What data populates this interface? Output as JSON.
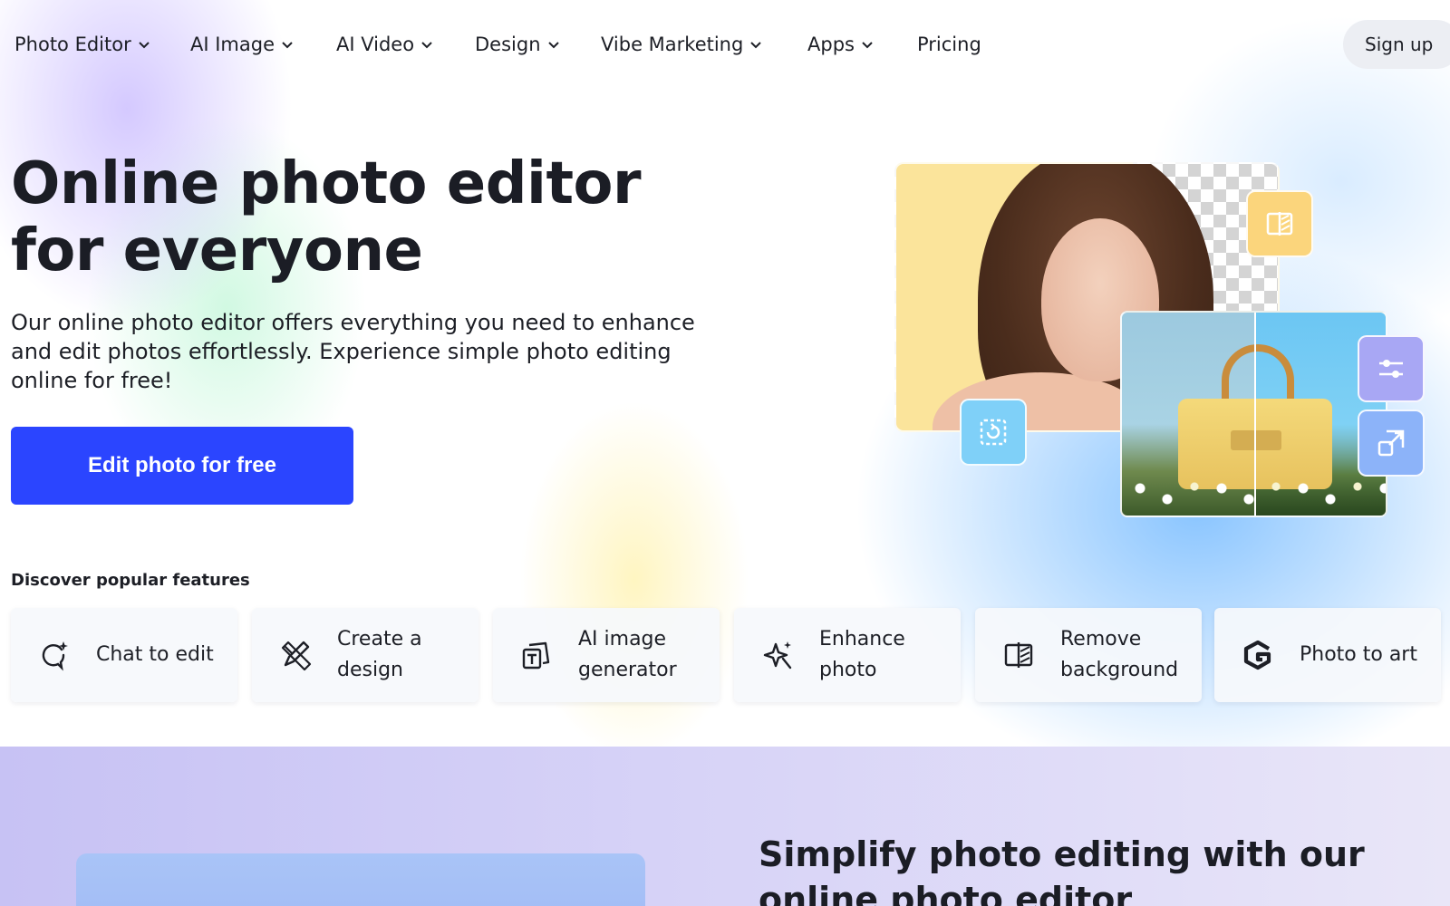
{
  "nav": {
    "items": [
      {
        "label": "Photo Editor",
        "dropdown": true
      },
      {
        "label": "AI Image",
        "dropdown": true
      },
      {
        "label": "AI Video",
        "dropdown": true
      },
      {
        "label": "Design",
        "dropdown": true
      },
      {
        "label": "Vibe Marketing",
        "dropdown": true
      },
      {
        "label": "Apps",
        "dropdown": true
      },
      {
        "label": "Pricing",
        "dropdown": false
      }
    ],
    "signup_label": "Sign up"
  },
  "hero": {
    "title": "Online photo editor for everyone",
    "subtitle": "Our online photo editor offers everything you need to enhance and edit photos effortlessly. Experience simple photo editing online for free!",
    "cta_label": "Edit photo for free",
    "collage_icons": [
      "remove-background-icon",
      "adjust-icon",
      "sliders-icon",
      "resize-icon"
    ]
  },
  "features": {
    "label": "Discover popular features",
    "items": [
      {
        "label": "Chat to edit",
        "icon": "chat-sparkle-icon"
      },
      {
        "label": "Create a design",
        "icon": "design-tools-icon"
      },
      {
        "label": "AI image generator",
        "icon": "text-image-icon"
      },
      {
        "label": "Enhance photo",
        "icon": "magic-sparkle-icon"
      },
      {
        "label": "Remove background",
        "icon": "remove-background-icon"
      },
      {
        "label": "Photo to art",
        "icon": "brand-logo-icon"
      }
    ]
  },
  "lower": {
    "title": "Simplify photo editing with our online photo editor"
  },
  "colors": {
    "cta": "#2b45ff",
    "text": "#1d1f26",
    "signup_bg": "#eceef3"
  }
}
